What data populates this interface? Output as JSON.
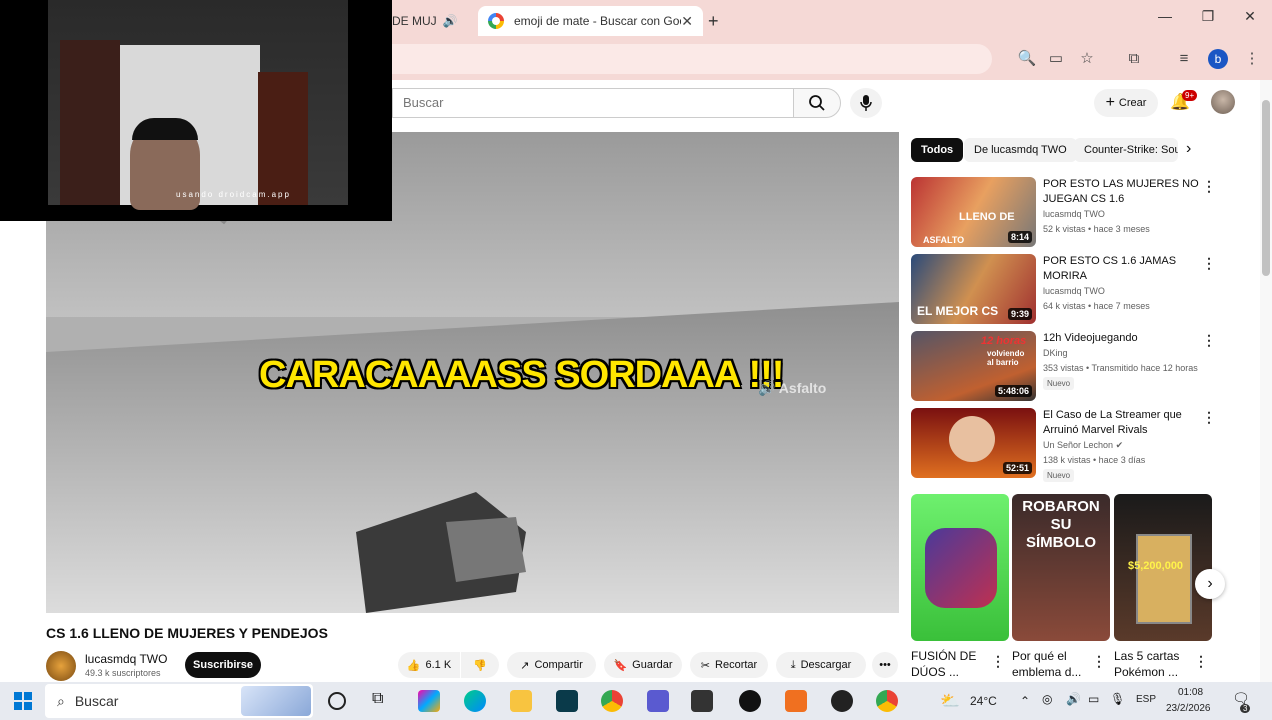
{
  "browser": {
    "tab1_label": "DE MUJ",
    "tab2_label": "emoji de mate - Buscar con Goo",
    "new_tab": "+",
    "win_controls": [
      "—",
      "❐",
      "✕"
    ],
    "profile_letter": "b"
  },
  "webcam": {
    "watermark": "usando droidcam.app"
  },
  "yt_header": {
    "search_placeholder": "Buscar",
    "create_label": "Crear",
    "notif_count": "9+"
  },
  "video": {
    "caption": "CARACAAAASS SORDAAA !!!",
    "overlay_sound": "🔊 Asfalto",
    "title": "CS 1.6 LLENO DE MUJERES Y PENDEJOS",
    "channel": "lucasmdq TWO",
    "subscribers": "49.3 k suscriptores",
    "subscribe_label": "Suscribirse",
    "likes": "6.1 K",
    "share_label": "Compartir",
    "save_label": "Guardar",
    "clip_label": "Recortar",
    "download_label": "Descargar"
  },
  "chips": [
    "Todos",
    "De lucasmdq TWO",
    "Counter-Strike: Sou"
  ],
  "recommendations": [
    {
      "title": "POR ESTO LAS MUJERES NO JUEGAN CS 1.6",
      "channel": "lucasmdq TWO",
      "meta": "52 k vistas • hace 3 meses",
      "duration": "8:14",
      "thumb_text": "LLENO DE",
      "thumb_text2": "ASFALTO",
      "badge": ""
    },
    {
      "title": "POR ESTO CS 1.6 JAMAS MORIRA",
      "channel": "lucasmdq TWO",
      "meta": "64 k vistas • hace 7 meses",
      "duration": "9:39",
      "thumb_text": "EL MEJOR CS",
      "thumb_text2": "",
      "badge": ""
    },
    {
      "title": "12h Videojuegando",
      "channel": "DKing",
      "meta": "353 vistas • Transmitido hace 12 horas",
      "duration": "5:48:06",
      "thumb_text": "12 horas",
      "thumb_text2": "volviendo al barrio",
      "badge": "Nuevo"
    },
    {
      "title": "El Caso de La Streamer que Arruinó Marvel Rivals",
      "channel": "Un Señor Lechon",
      "meta": "138 k vistas • hace 3 días",
      "duration": "52:51",
      "thumb_text": "",
      "thumb_text2": "",
      "badge": "Nuevo"
    }
  ],
  "shorts": [
    {
      "title": "FUSIÓN DE DÚOS ...",
      "thumb_text": ""
    },
    {
      "title": "Por qué el emblema d...",
      "thumb_text": "ROBARON SU SÍMBOLO"
    },
    {
      "title": "Las 5 cartas Pokémon ...",
      "thumb_text": "$5,200,000"
    }
  ],
  "taskbar": {
    "search_placeholder": "Buscar",
    "weather": "24°C",
    "lang": "ESP",
    "time": "01:08",
    "date": "23/2/2026",
    "notif": "3"
  }
}
